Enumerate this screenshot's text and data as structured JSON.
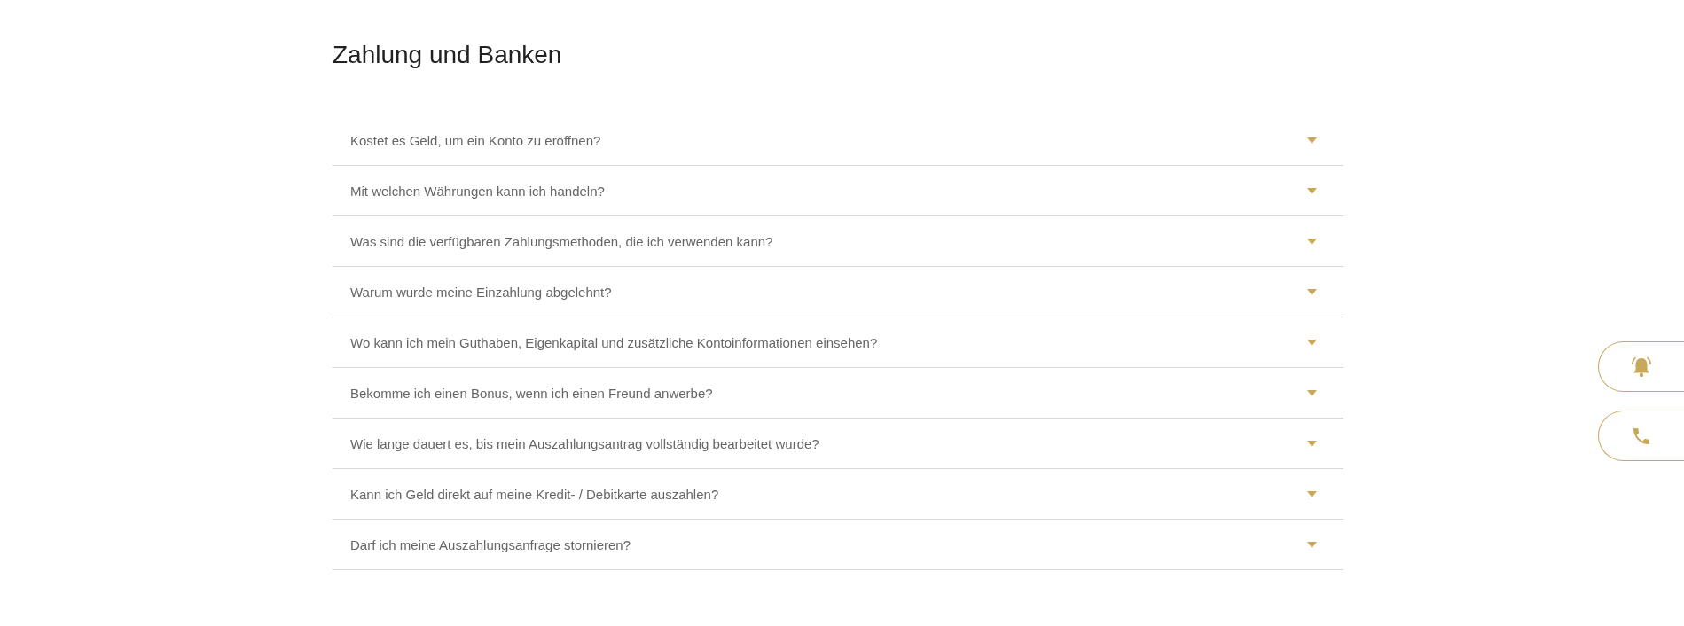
{
  "section": {
    "title": "Zahlung und Banken"
  },
  "faq": [
    {
      "question": "Kostet es Geld, um ein Konto zu eröffnen?",
      "expanded": false
    },
    {
      "question": "Mit welchen Währungen kann ich handeln?",
      "expanded": false
    },
    {
      "question": "Was sind die verfügbaren Zahlungsmethoden, die ich verwenden kann?",
      "expanded": false
    },
    {
      "question": "Warum wurde meine Einzahlung abgelehnt?",
      "expanded": false
    },
    {
      "question": "Wo kann ich mein Guthaben, Eigenkapital und zusätzliche Kontoinformationen einsehen?",
      "expanded": false
    },
    {
      "question": "Bekomme ich einen Bonus, wenn ich einen Freund anwerbe?",
      "expanded": false
    },
    {
      "question": "Wie lange dauert es, bis mein Auszahlungsantrag vollständig bearbeitet wurde?",
      "expanded": false
    },
    {
      "question": "Kann ich Geld direkt auf meine Kredit- / Debitkarte auszahlen?",
      "expanded": false
    },
    {
      "question": "Darf ich meine Auszahlungsanfrage stornieren?",
      "expanded": false
    }
  ],
  "side_buttons": [
    {
      "kind": "bell"
    },
    {
      "kind": "phone"
    }
  ]
}
